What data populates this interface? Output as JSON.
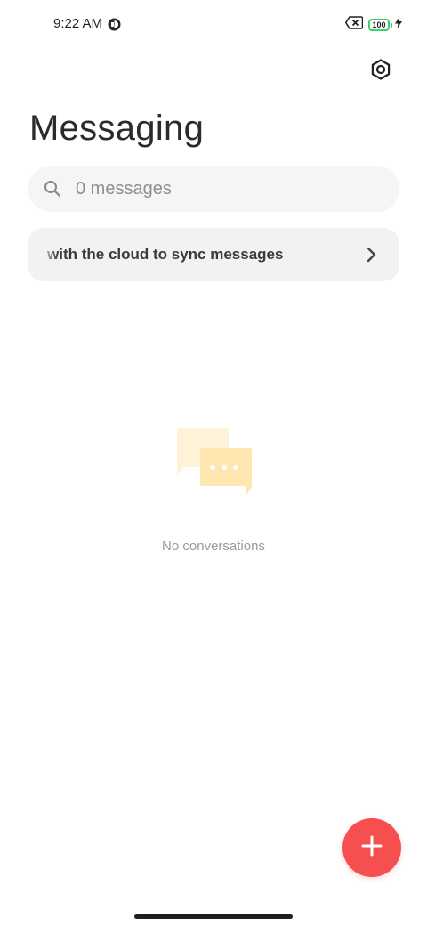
{
  "status_bar": {
    "time": "9:22 AM",
    "battery_level": "100"
  },
  "header": {
    "title": "Messaging",
    "settings_icon": "settings-icon"
  },
  "search": {
    "placeholder": "0 messages",
    "icon": "search-icon"
  },
  "sync_banner": {
    "text": "with the cloud to sync messages",
    "icon": "chevron-right-icon"
  },
  "empty_state": {
    "text": "No conversations",
    "icon": "chat-bubbles-icon"
  },
  "fab": {
    "icon": "plus-icon",
    "color": "#f54f4f"
  },
  "colors": {
    "accent": "#f54f4f",
    "battery": "#3fcf6e",
    "illustration": "#fde6b0"
  }
}
